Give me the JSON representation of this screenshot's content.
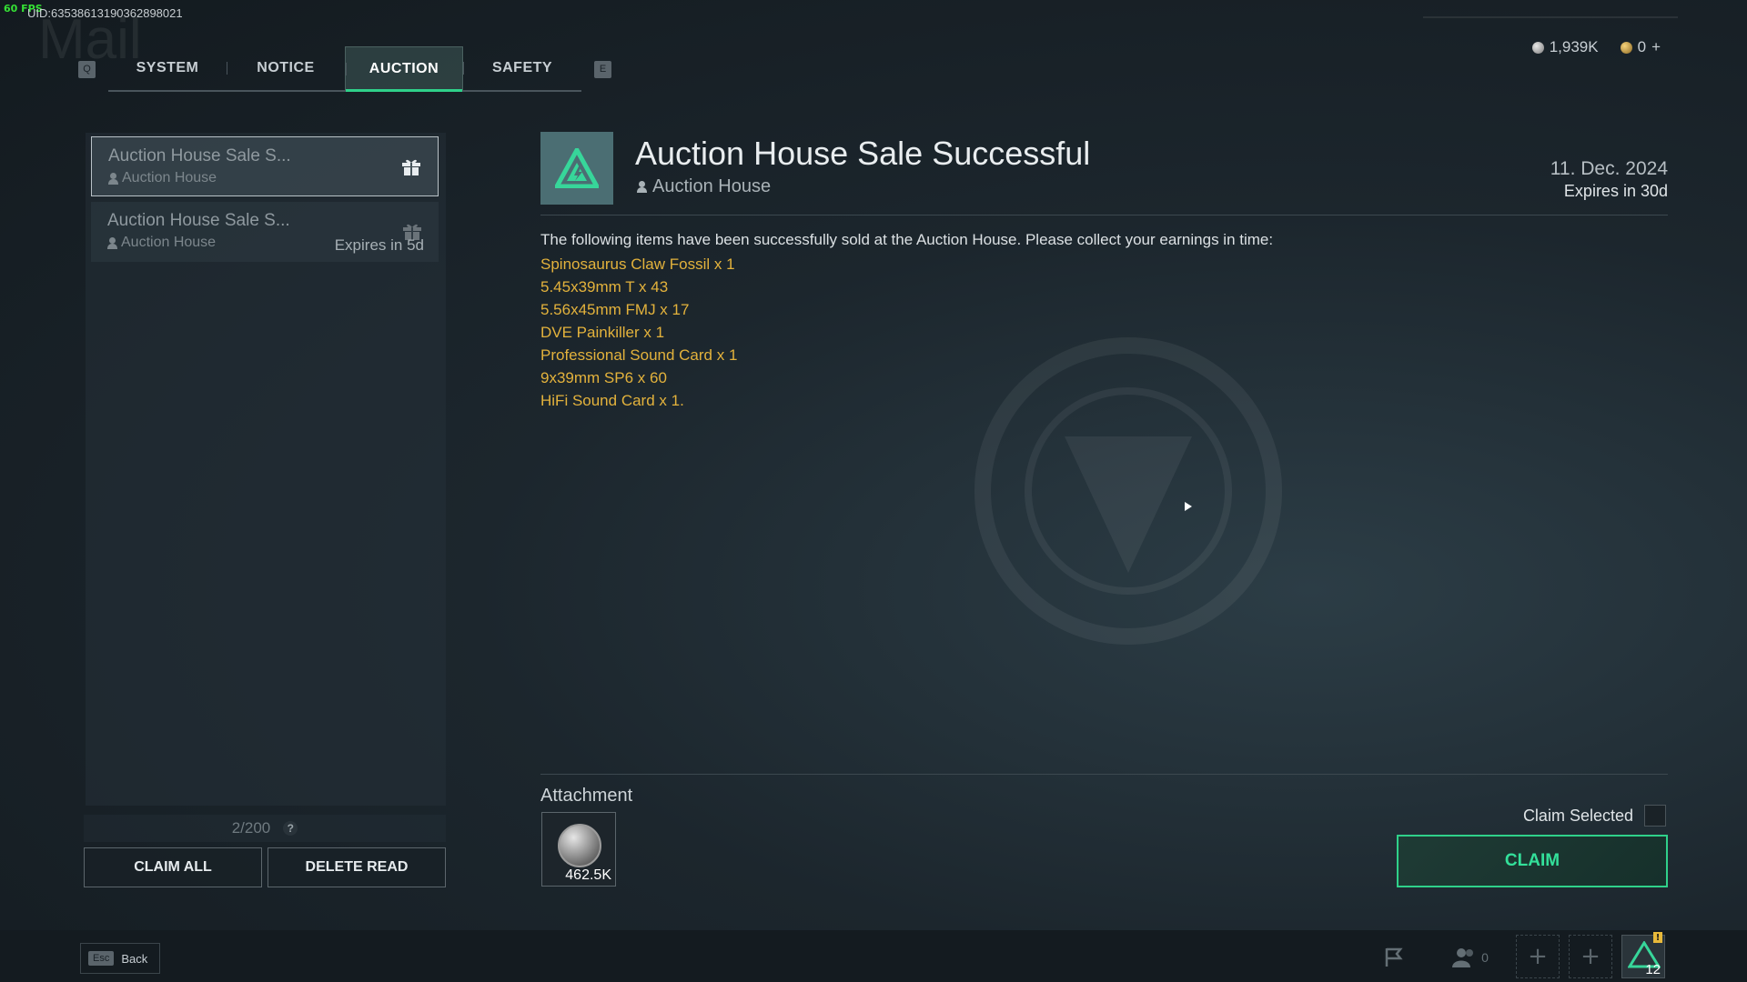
{
  "overlay": {
    "fps": "60 FPS",
    "uid": "UID:635386131903628980​21"
  },
  "header": {
    "ghost_title": "Mail"
  },
  "tabs": {
    "prev_key": "Q",
    "next_key": "E",
    "items": [
      {
        "label": "SYSTEM",
        "active": false
      },
      {
        "label": "NOTICE",
        "active": false
      },
      {
        "label": "AUCTION",
        "active": true
      },
      {
        "label": "SAFETY",
        "active": false
      }
    ]
  },
  "currency": {
    "silver": "1,939K",
    "gold": "0",
    "add": "+"
  },
  "mail_list": {
    "items": [
      {
        "title": "Auction House Sale S...",
        "from": "Auction House",
        "expires": ""
      },
      {
        "title": "Auction House Sale S...",
        "from": "Auction House",
        "expires": "Expires in 5d"
      }
    ],
    "count": "2/200",
    "help": "?",
    "claim_all": "CLAIM ALL",
    "delete_read": "DELETE READ"
  },
  "detail": {
    "title": "Auction House Sale Successful",
    "from": "Auction House",
    "date": "11. Dec. 2024",
    "expires": "Expires in 30d",
    "body": "The following items have been successfully sold at the Auction House. Please collect your earnings in time:",
    "items": [
      "Spinosaurus Claw Fossil x 1",
      "5.45x39mm T x 43",
      "5.56x45mm FMJ x 17",
      "DVE Painkiller x 1",
      "Professional Sound Card x 1",
      "9x39mm SP6 x 60",
      "HiFi Sound Card x 1."
    ]
  },
  "attachment": {
    "label": "Attachment",
    "quantity": "462.5K",
    "claim_selected": "Claim Selected",
    "claim": "CLAIM"
  },
  "bottom": {
    "esc_key": "Esc",
    "back": "Back",
    "friends_count": "0",
    "slot_plus": "+",
    "level": "12",
    "badge": "!"
  },
  "colors": {
    "accent": "#2fd18a",
    "item_gold": "#e3b23c",
    "emblem_bg": "#4b6e73"
  }
}
